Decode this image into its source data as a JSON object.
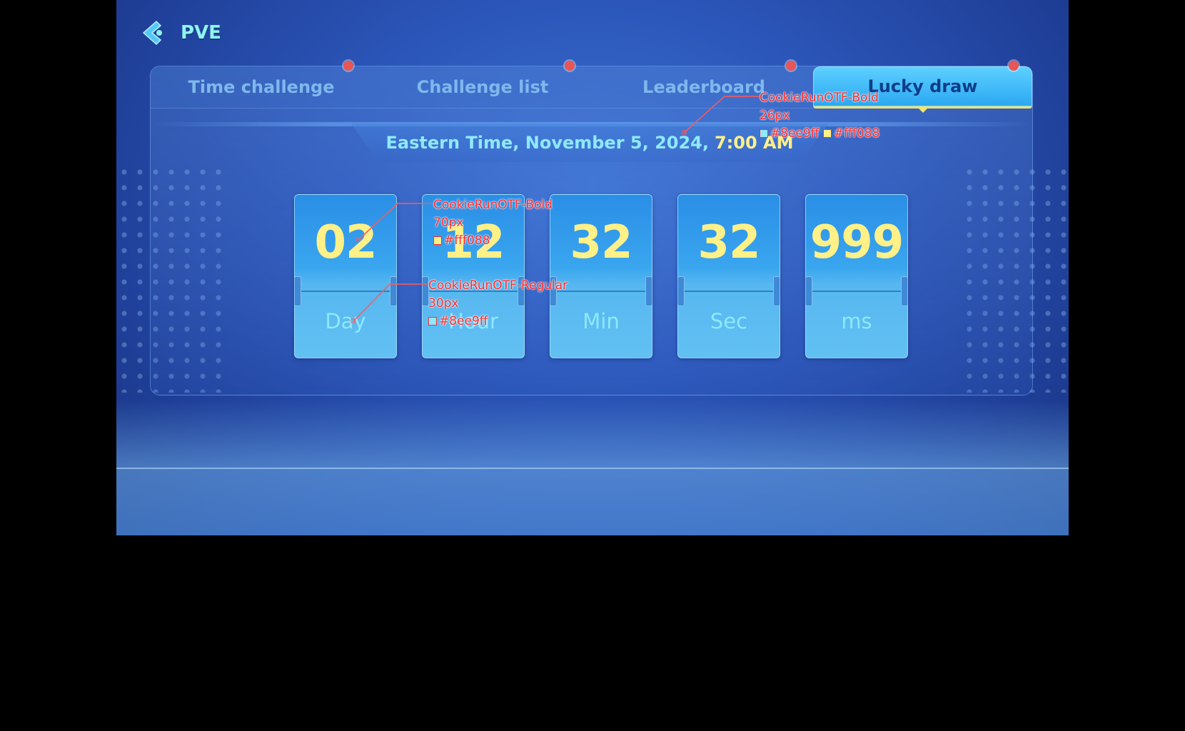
{
  "header": {
    "title": "PVE",
    "back_icon": "back-arrow-icon"
  },
  "tabs": [
    {
      "label": "Time challenge",
      "active": false
    },
    {
      "label": "Challenge list",
      "active": false
    },
    {
      "label": "Leaderboard",
      "active": false
    },
    {
      "label": "Lucky draw",
      "active": true
    }
  ],
  "date": {
    "prefix": "Eastern Time, November 5, 2024,",
    "time": "7:00 AM"
  },
  "countdown": [
    {
      "value": "02",
      "unit": "Day"
    },
    {
      "value": "12",
      "unit": "Hour"
    },
    {
      "value": "32",
      "unit": "Min"
    },
    {
      "value": "32",
      "unit": "Sec"
    },
    {
      "value": "999",
      "unit": "ms"
    }
  ],
  "annotations": {
    "date": {
      "font": "CookieRunOTF-Bold",
      "size": "26px",
      "color1": "#8ee9ff",
      "color2": "#fff088"
    },
    "value": {
      "font": "CookieRunOTF-Bold",
      "size": "70px",
      "color": "#fff088"
    },
    "unit": {
      "font": "CookieRunOTF-Regular",
      "size": "30px",
      "color": "#8ee9ff"
    }
  },
  "colors": {
    "highlight": "#fff088",
    "cyan_text": "#8ee9ff",
    "active_tab": "#2aa8f2",
    "badge": "#e85555"
  }
}
